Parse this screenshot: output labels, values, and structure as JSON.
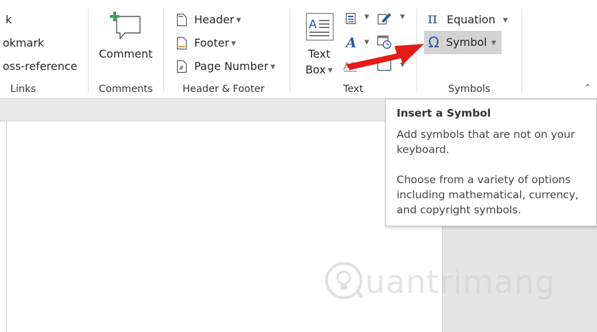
{
  "links": {
    "item1": "k",
    "item2": "okmark",
    "item3": "oss-reference",
    "group_label": "Links"
  },
  "comments": {
    "button_label": "Comment",
    "group_label": "Comments"
  },
  "header_footer": {
    "header_label": "Header",
    "footer_label": "Footer",
    "page_number_label": "Page Number",
    "group_label": "Header & Footer"
  },
  "text_group": {
    "text_box_line1": "Text",
    "text_box_line2": "Box",
    "group_label": "Text"
  },
  "symbols": {
    "equation_glyph": "π",
    "equation_label": "Equation",
    "symbol_glyph": "Ω",
    "symbol_label": "Symbol",
    "group_label": "Symbols"
  },
  "tooltip": {
    "title": "Insert a Symbol",
    "line1": "Add symbols that are not on your",
    "line2": "keyboard.",
    "line3": "Choose from a variety of options",
    "line4": "including mathematical, currency,",
    "line5": "and copyright symbols."
  },
  "watermark": {
    "text": "uantrimang"
  },
  "colors": {
    "accent_blue": "#2b579a",
    "arrow_red": "#e41b17",
    "comment_plus_green": "#3e9e5a"
  }
}
